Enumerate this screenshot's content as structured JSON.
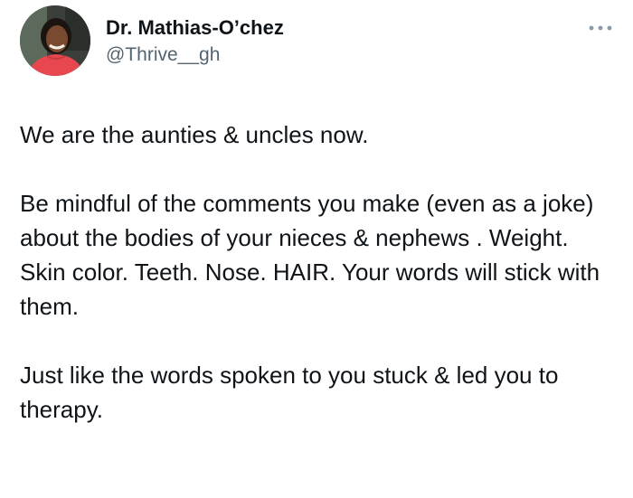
{
  "author": {
    "display_name": "Dr. Mathias-O’chez",
    "handle": "@Thrive__gh",
    "avatar_icon": "profile-photo"
  },
  "more_icon": "more-options-icon",
  "tweet": {
    "paragraphs": [
      "We are the aunties & uncles now.",
      "Be mindful of the comments you make (even as a joke) about the bodies of your nieces & nephews . Weight. Skin color. Teeth. Nose. HAIR. Your words will stick with them.",
      "Just like the words spoken to you stuck & led you to therapy."
    ]
  },
  "colors": {
    "text": "#0f1419",
    "secondary": "#536471",
    "avatar_shirt": "#e8474f"
  }
}
